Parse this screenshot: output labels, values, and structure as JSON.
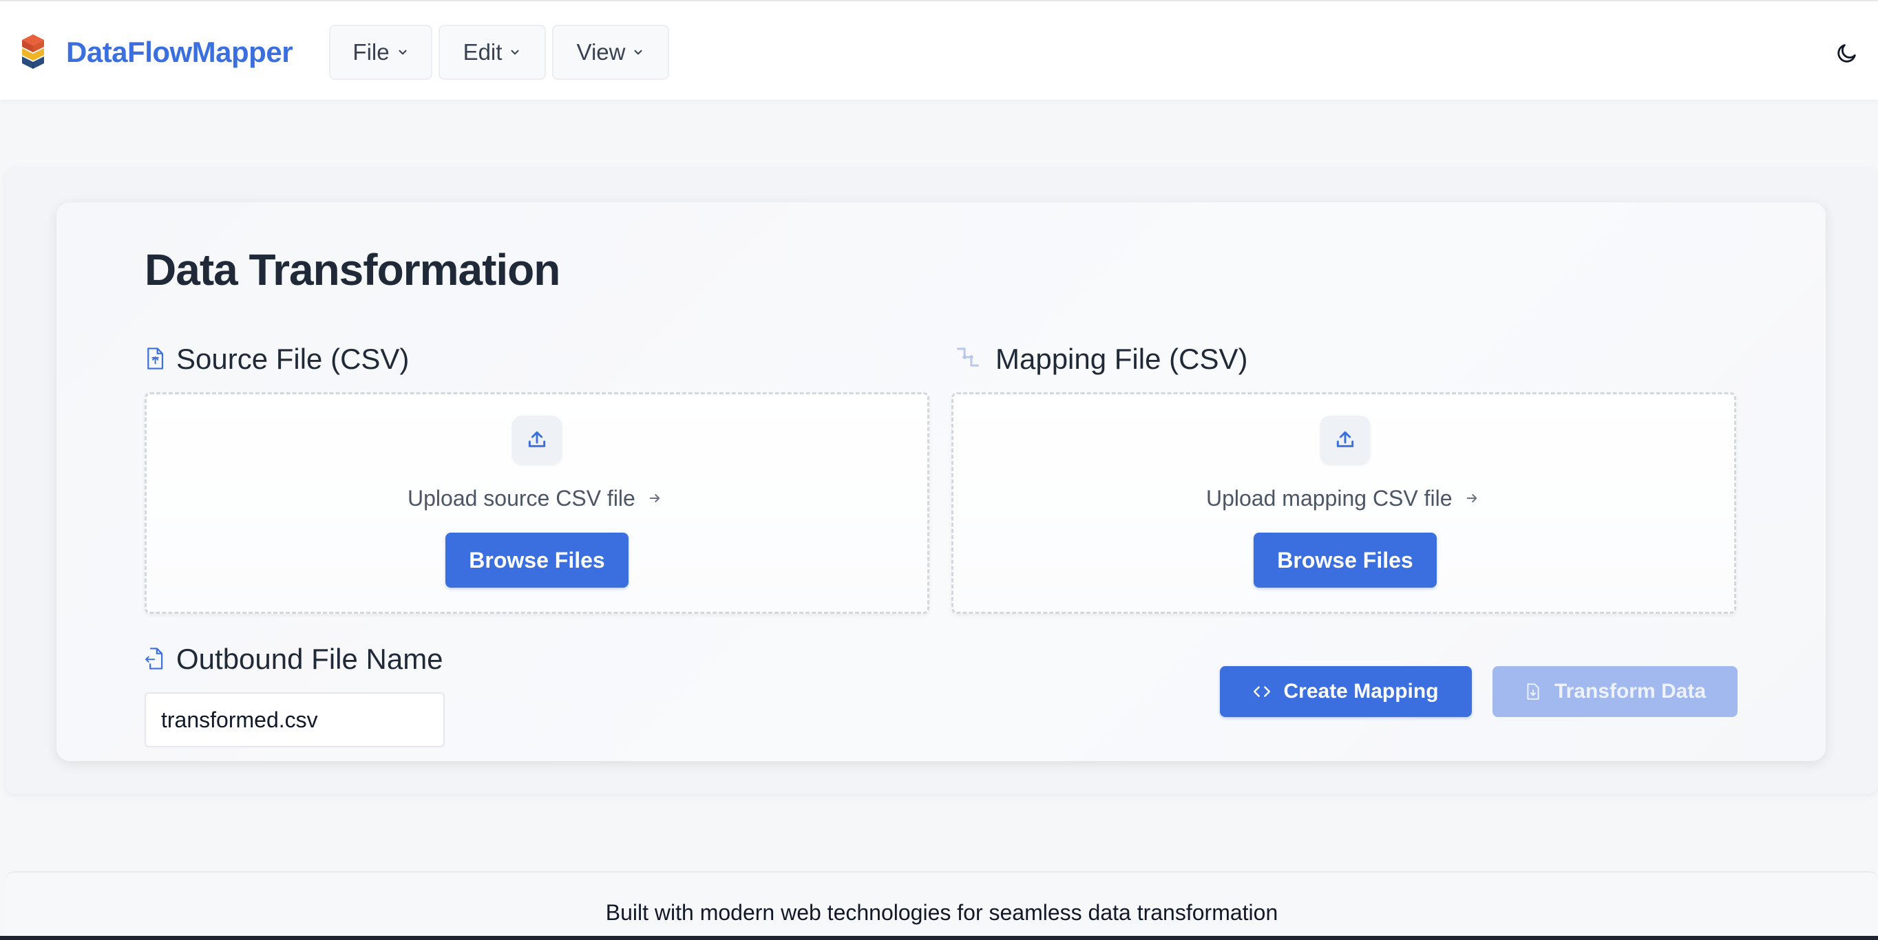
{
  "header": {
    "brand": "DataFlowMapper",
    "menus": [
      {
        "label": "File"
      },
      {
        "label": "Edit"
      },
      {
        "label": "View"
      }
    ],
    "icons": {
      "logo": "stacked-layers-logo-icon",
      "theme": "moon-icon"
    }
  },
  "main": {
    "title": "Data Transformation",
    "source": {
      "label": "Source File (CSV)",
      "upload_text": "Upload source CSV file",
      "browse_label": "Browse Files"
    },
    "mapping": {
      "label": "Mapping File (CSV)",
      "upload_text": "Upload mapping CSV file",
      "browse_label": "Browse Files"
    },
    "outbound": {
      "label": "Outbound File Name",
      "value": "transformed.csv"
    },
    "actions": {
      "create_mapping": "Create Mapping",
      "transform_data": "Transform Data"
    }
  },
  "footer": {
    "text": "Built with modern web technologies for seamless data transformation"
  },
  "colors": {
    "accent": "#3b6fe0",
    "accent_disabled": "#a2b9f0",
    "background": "#f6f7f9"
  }
}
